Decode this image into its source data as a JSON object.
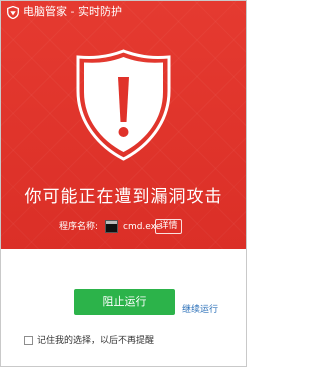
{
  "window": {
    "title": "电脑管家 - 实时防护",
    "accent_color": "#e0322a",
    "logo_icon": "shield-logo-icon"
  },
  "alert": {
    "icon": "warning-shield-icon",
    "headline": "你可能正在遭到漏洞攻击",
    "program_label": "程序名称:",
    "program_icon": "cmd-console-icon",
    "program_name": "cmd.exe",
    "details_label": "详情"
  },
  "actions": {
    "block_label": "阻止运行",
    "block_color": "#2cb34a",
    "continue_label": "继续运行",
    "link_color": "#2a6fb8"
  },
  "remember": {
    "label": "记住我的选择，以后不再提醒",
    "checked": false
  }
}
